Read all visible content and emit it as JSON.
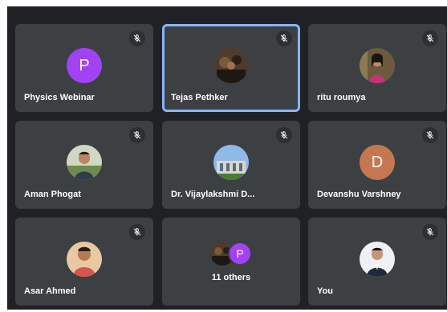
{
  "tiles": [
    {
      "name": "Physics Webinar",
      "initial": "P",
      "avatar_color": "#a142f4",
      "muted": true
    },
    {
      "name": "Tejas Pethker",
      "muted": true,
      "active": true
    },
    {
      "name": "ritu roumya",
      "muted": true
    },
    {
      "name": "Aman Phogat",
      "muted": true
    },
    {
      "name": "Dr. Vijaylakshmi D...",
      "muted": true
    },
    {
      "name": "Devanshu Varshney",
      "initial": "D",
      "avatar_color": "#c5774f",
      "muted": true
    },
    {
      "name": "Asar Ahmed",
      "muted": true
    },
    {
      "label": "11 others",
      "initial": "P",
      "avatar_color": "#a142f4"
    },
    {
      "name": "You",
      "muted": true
    }
  ],
  "colors": {
    "background": "#202124",
    "tile": "#3c4043",
    "active_border": "#8ab4f8"
  },
  "icons": {
    "muted": "mic-off-icon"
  }
}
